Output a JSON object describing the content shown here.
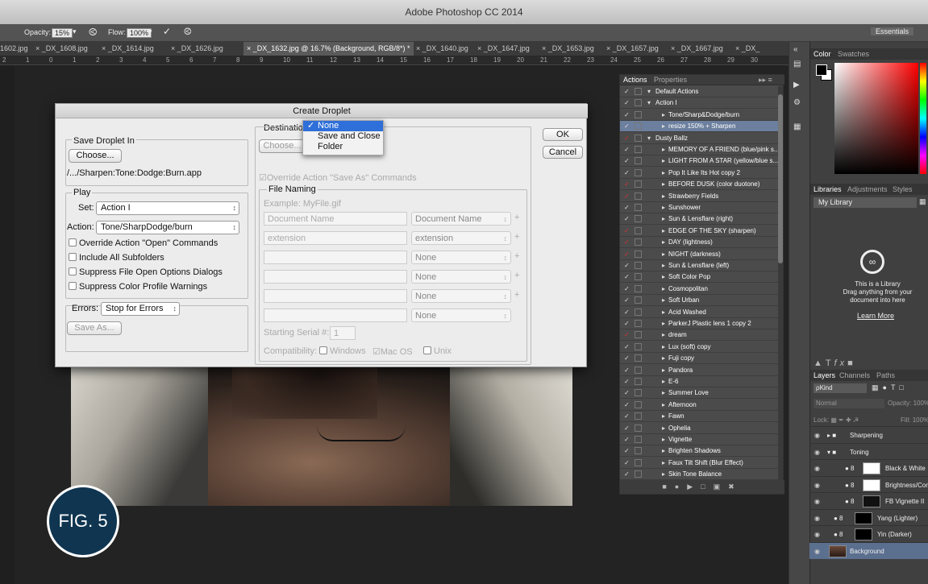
{
  "app_title": "Adobe Photoshop CC 2014",
  "options": {
    "opacity_label": "Opacity:",
    "opacity_value": "15%",
    "flow_label": "Flow:",
    "flow_value": "100%",
    "workspace": "Essentials"
  },
  "tabs": [
    "1602.jpg",
    "× _DX_1608.jpg",
    "× _DX_1614.jpg",
    "× _DX_1626.jpg",
    "× _DX_1632.jpg @ 16.7% (Background, RGB/8*) *",
    "× _DX_1640.jpg",
    "× _DX_1647.jpg",
    "× _DX_1653.jpg",
    "× _DX_1657.jpg",
    "× _DX_1667.jpg",
    "× _DX_"
  ],
  "ruler_marks": [
    "2",
    "1",
    "0",
    "1",
    "2",
    "3",
    "4",
    "5",
    "6",
    "7",
    "8",
    "9",
    "10",
    "11",
    "12",
    "13",
    "14",
    "15",
    "16",
    "17",
    "18",
    "19",
    "20",
    "21",
    "22",
    "23",
    "24",
    "25",
    "26",
    "27",
    "28",
    "29",
    "30"
  ],
  "figure_badge": "FIG. 5",
  "dialog": {
    "title": "Create Droplet",
    "save_in_label": "Save Droplet In",
    "choose_label": "Choose...",
    "droplet_path": "/.../Sharpen:Tone:Dodge:Burn.app",
    "play_label": "Play",
    "set_label": "Set:",
    "set_value": "Action I",
    "action_label": "Action:",
    "action_value": "Tone/SharpDodge/burn",
    "checkboxes": [
      "Override Action \"Open\" Commands",
      "Include All Subfolders",
      "Suppress File Open Options Dialogs",
      "Suppress Color Profile Warnings"
    ],
    "errors_label": "Errors:",
    "errors_value": "Stop for Errors",
    "save_as_label": "Save As...",
    "destination_label": "Destination:",
    "destination_options": [
      "None",
      "Save and Close",
      "Folder"
    ],
    "dest_choose_label": "Choose...",
    "override_save_as": "Override Action \"Save As\" Commands",
    "file_naming_label": "File Naming",
    "example": "Example: MyFile.gif",
    "naming_fields": [
      "Document Name",
      "extension",
      "",
      "",
      "",
      ""
    ],
    "naming_selects": [
      "Document Name",
      "extension",
      "None",
      "None",
      "None",
      "None"
    ],
    "serial_label": "Starting Serial #:",
    "serial_value": "1",
    "compat_label": "Compatibility:",
    "compat_windows": "Windows",
    "compat_mac": "Mac OS",
    "compat_unix": "Unix",
    "ok_label": "OK",
    "cancel_label": "Cancel"
  },
  "actions_panel": {
    "tab_actions": "Actions",
    "tab_properties": "Properties",
    "rows": [
      {
        "text": "Default Actions",
        "level": 0,
        "red": false
      },
      {
        "text": "Action I",
        "level": 0,
        "red": false
      },
      {
        "text": "Tone/Sharp&Dodge/burn",
        "level": 1,
        "red": false
      },
      {
        "text": "resize 150% + Sharpen",
        "level": 1,
        "red": false
      },
      {
        "text": "Dusty Ballz",
        "level": 0,
        "red": true
      },
      {
        "text": "MEMORY OF A FRIEND (blue/pink s...",
        "level": 1,
        "red": false
      },
      {
        "text": "LIGHT FROM A STAR (yellow/blue s...",
        "level": 1,
        "red": false
      },
      {
        "text": "Pop It Like Its Hot copy 2",
        "level": 1,
        "red": false
      },
      {
        "text": "BEFORE DUSK (color duotone)",
        "level": 1,
        "red": true
      },
      {
        "text": "Strawberry Fields",
        "level": 1,
        "red": true
      },
      {
        "text": "Sunshower",
        "level": 1,
        "red": false
      },
      {
        "text": "Sun & Lensflare (right)",
        "level": 1,
        "red": false
      },
      {
        "text": "EDGE OF THE SKY (sharpen)",
        "level": 1,
        "red": true
      },
      {
        "text": "DAY (lightness)",
        "level": 1,
        "red": true
      },
      {
        "text": "NIGHT (darkness)",
        "level": 1,
        "red": true
      },
      {
        "text": "Sun & Lensflare (left)",
        "level": 1,
        "red": false
      },
      {
        "text": "Soft Color Pop",
        "level": 1,
        "red": false
      },
      {
        "text": "Cosmopolitan",
        "level": 1,
        "red": false
      },
      {
        "text": "Soft Urban",
        "level": 1,
        "red": false
      },
      {
        "text": "Acid Washed",
        "level": 1,
        "red": false
      },
      {
        "text": "ParkerJ Plastic lens 1 copy 2",
        "level": 1,
        "red": false
      },
      {
        "text": "dream",
        "level": 1,
        "red": true
      },
      {
        "text": "Lux (soft) copy",
        "level": 1,
        "red": false
      },
      {
        "text": "Fuji copy",
        "level": 1,
        "red": false
      },
      {
        "text": "Pandora",
        "level": 1,
        "red": false
      },
      {
        "text": "E-6",
        "level": 1,
        "red": false
      },
      {
        "text": "Summer Love",
        "level": 1,
        "red": false
      },
      {
        "text": "Afternoon",
        "level": 1,
        "red": false
      },
      {
        "text": "Fawn",
        "level": 1,
        "red": false
      },
      {
        "text": "Ophelia",
        "level": 1,
        "red": false
      },
      {
        "text": "Vignette",
        "level": 1,
        "red": false
      },
      {
        "text": "Brighten Shadows",
        "level": 1,
        "red": false
      },
      {
        "text": "Faux Tilt Shift (Blur Effect)",
        "level": 1,
        "red": false
      },
      {
        "text": "Skin Tone Balance",
        "level": 1,
        "red": false
      }
    ]
  },
  "color_panel": {
    "tab_color": "Color",
    "tab_swatches": "Swatches"
  },
  "libraries": {
    "tab_libraries": "Libraries",
    "tab_adjustments": "Adjustments",
    "tab_styles": "Styles",
    "library_name": "My Library",
    "message": "This is a Library",
    "sub1": "Drag anything from your",
    "sub2": "document into here",
    "learn_more": "Learn More"
  },
  "layers": {
    "tab_layers": "Layers",
    "tab_channels": "Channels",
    "tab_paths": "Paths",
    "kind": "Kind",
    "blend": "Normal",
    "opacity_label": "Opacity:",
    "opacity_value": "100%",
    "lock_label": "Lock:",
    "fill_label": "Fill:",
    "fill_value": "100%",
    "items": [
      "Sharpening",
      "Toning",
      "Black & White",
      "Brightness/Con...",
      "FB Vignette II",
      "Yang (Lighter)",
      "Yin (Darker)",
      "Background"
    ]
  },
  "colors": {
    "selected": "#2f6fd9",
    "badge": "#0f3550"
  }
}
